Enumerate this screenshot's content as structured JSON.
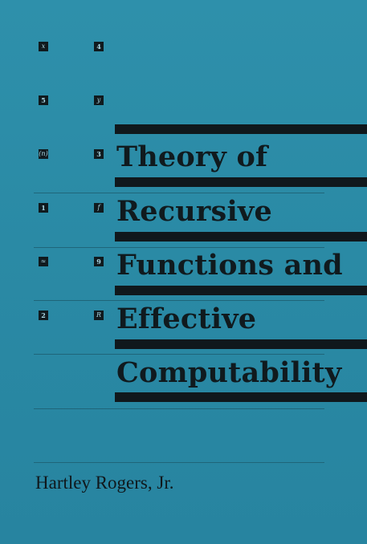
{
  "cover": {
    "title_lines": [
      "Theory of",
      "Recursive",
      "Functions and",
      "Effective",
      "Computability"
    ],
    "author": "Hartley Rogers, Jr.",
    "squares_left": [
      "x",
      "5",
      "(n)",
      "1",
      "≈",
      "2"
    ],
    "squares_right": [
      "4",
      "y",
      "3",
      "f",
      "9",
      "R"
    ],
    "colors": {
      "background": "#2a8ba6",
      "ink": "#10181c"
    }
  }
}
